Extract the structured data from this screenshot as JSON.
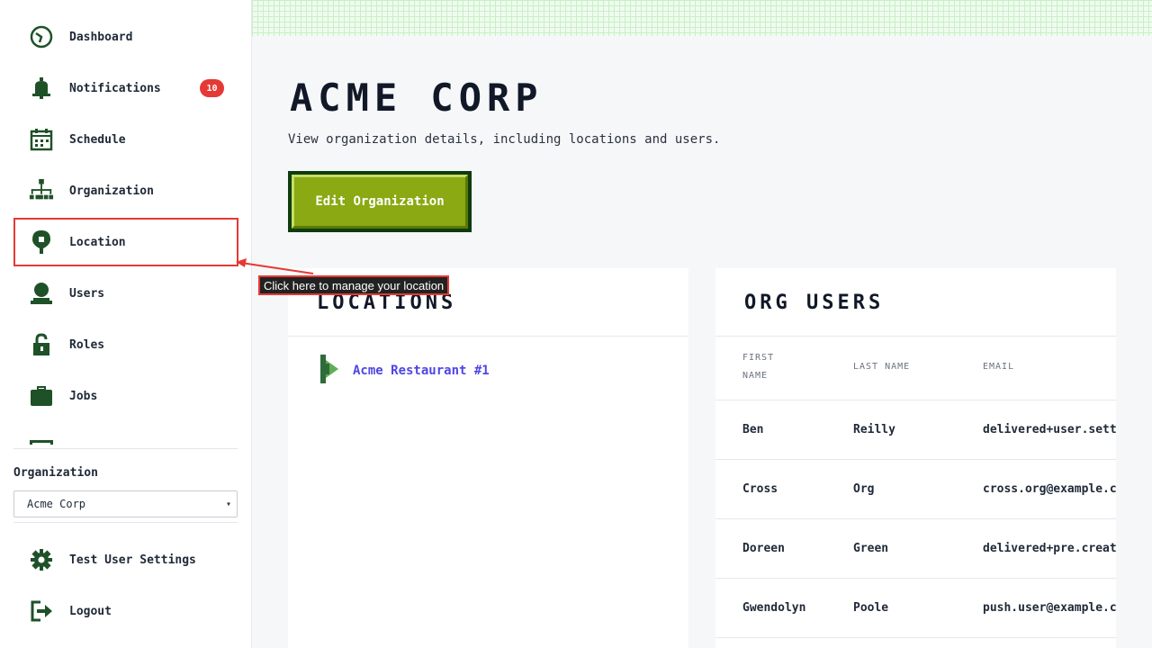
{
  "sidebar": {
    "items": [
      {
        "label": "Dashboard",
        "icon": "dashboard-icon"
      },
      {
        "label": "Notifications",
        "icon": "bell-icon",
        "badge": "10"
      },
      {
        "label": "Schedule",
        "icon": "calendar-icon"
      },
      {
        "label": "Organization",
        "icon": "org-chart-icon"
      },
      {
        "label": "Location",
        "icon": "map-pin-icon"
      },
      {
        "label": "Users",
        "icon": "user-icon"
      },
      {
        "label": "Roles",
        "icon": "lock-icon"
      },
      {
        "label": "Jobs",
        "icon": "briefcase-icon"
      }
    ],
    "org_label": "Organization",
    "org_selected": "Acme Corp",
    "bottom": [
      {
        "label": "Test User Settings",
        "icon": "gear-icon"
      },
      {
        "label": "Logout",
        "icon": "logout-icon"
      }
    ]
  },
  "main": {
    "title": "ACME CORP",
    "subtitle": "View organization details, including locations and users.",
    "edit_button": "Edit Organization"
  },
  "locations": {
    "title": "LOCATIONS",
    "items": [
      "Acme Restaurant #1"
    ]
  },
  "org_users": {
    "title": "ORG USERS",
    "headers": [
      "FIRST",
      "NAME",
      "LAST NAME",
      "EMAIL"
    ],
    "rows": [
      [
        "Ben",
        "Reilly",
        "delivered+user.settin"
      ],
      [
        "Cross",
        "Org",
        "cross.org@example.com"
      ],
      [
        "Doreen",
        "Green",
        "delivered+pre.created"
      ],
      [
        "Gwendolyn",
        "Poole",
        "push.user@example.com"
      ]
    ]
  },
  "tooltip": "Click here to manage your location",
  "colors": {
    "accent_green": "#8aa912",
    "dark_green": "#0f3d0f",
    "icon_green": "#1f5128",
    "badge_red": "#e53935",
    "link_indigo": "#4f46e5"
  }
}
